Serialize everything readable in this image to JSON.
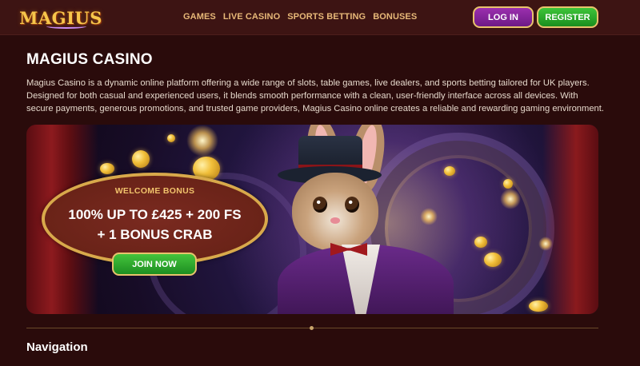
{
  "header": {
    "logo_text": "MAGIUS",
    "nav": [
      "GAMES",
      "LIVE CASINO",
      "SPORTS BETTING",
      "BONUSES"
    ],
    "login_label": "LOG IN",
    "register_label": "REGISTER"
  },
  "main": {
    "title": "MAGIUS CASINO",
    "intro": "Magius Casino is a dynamic online platform offering a wide range of slots, table games, live dealers, and sports betting tailored for UK players. Designed for both casual and experienced users, it blends smooth performance with a clean, user-friendly interface across all devices. With secure payments, generous promotions, and trusted game providers, Magius Casino online creates a reliable and rewarding gaming environment."
  },
  "banner": {
    "bonus_label": "WELCOME BONUS",
    "bonus_line1": "100% UP TO £425 + 200 FS",
    "bonus_line2": "+ 1 BONUS CRAB",
    "join_label": "JOIN NOW"
  },
  "section": {
    "heading": "Navigation"
  },
  "colors": {
    "background": "#2a0b0b",
    "header": "#3d1413",
    "gold": "#e8c36c",
    "login": "#8a26a0",
    "register": "#2ea82c"
  }
}
